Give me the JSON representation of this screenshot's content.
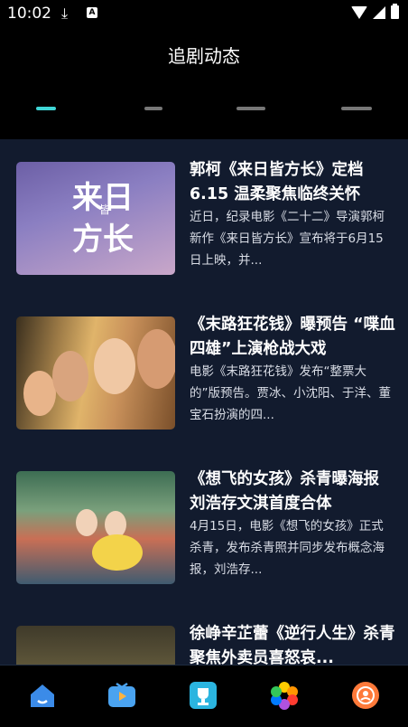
{
  "status": {
    "time": "10:02",
    "download_icon": "download-icon",
    "a_icon": "A"
  },
  "header": {
    "title": "追剧动态"
  },
  "tabs": [
    {
      "label": ""
    },
    {
      "label": ""
    },
    {
      "label": ""
    },
    {
      "label": ""
    }
  ],
  "articles": [
    {
      "title": "郭柯《来日皆方长》定档6.15 温柔聚焦临终关怀",
      "desc": "近日，纪录电影《二十二》导演郭柯新作《来日皆方长》宣布将于6月15日上映，并...",
      "thumb_text_1": "来日",
      "thumb_text_2": "方长",
      "thumb_text_3": "皆"
    },
    {
      "title": "《末路狂花钱》曝预告 “喋血四雄”上演枪战大戏",
      "desc": "电影《末路狂花钱》发布“整票大的”版预告。贾冰、小沈阳、于洋、董宝石扮演的四..."
    },
    {
      "title": "《想飞的女孩》杀青曝海报 刘浩存文淇首度合体",
      "desc": "4月15日，电影《想飞的女孩》正式杀青，发布杀青照并同步发布概念海报，刘浩存..."
    },
    {
      "title": "徐峥辛芷蕾《逆行人生》杀青 聚焦外卖员喜怒哀...",
      "desc": ""
    }
  ],
  "bottom_nav": [
    {
      "name": "home-icon",
      "color": "#3b8be8"
    },
    {
      "name": "tv-icon",
      "color": "#4aa3f0"
    },
    {
      "name": "trophy-icon",
      "color": "#2bb5e0"
    },
    {
      "name": "photos-icon",
      "color": "#ff5a4d"
    },
    {
      "name": "profile-icon",
      "color": "#ff7a3a"
    }
  ]
}
